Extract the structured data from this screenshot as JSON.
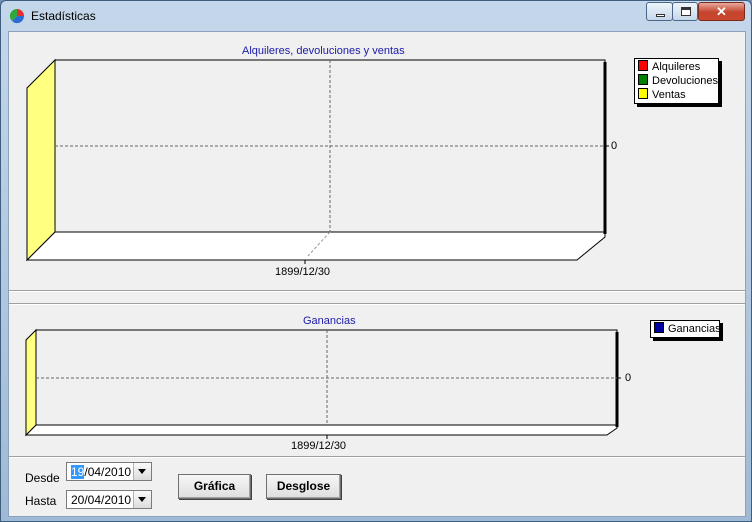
{
  "window": {
    "title": "Estadísticas",
    "close_glyph": "✕"
  },
  "chart_data": [
    {
      "type": "bar",
      "title": "Alquileres, devoluciones y ventas",
      "categories": [
        "1899/12/30"
      ],
      "series": [
        {
          "name": "Alquileres",
          "color": "#ff0000",
          "values": [
            0
          ]
        },
        {
          "name": "Devoluciones",
          "color": "#008000",
          "values": [
            0
          ]
        },
        {
          "name": "Ventas",
          "color": "#ffff00",
          "values": [
            0
          ]
        }
      ],
      "y_ticks": [
        "0"
      ],
      "grid": true,
      "legend": "top-right",
      "wall_color": "#ffff80"
    },
    {
      "type": "bar",
      "title": "Ganancias",
      "categories": [
        "1899/12/30"
      ],
      "series": [
        {
          "name": "Ganancias",
          "color": "#0000a0",
          "values": [
            0
          ]
        }
      ],
      "y_ticks": [
        "0"
      ],
      "grid": true,
      "legend": "top-right",
      "wall_color": "#ffff80"
    }
  ],
  "filters": {
    "desde_label": "Desde",
    "desde_day": "19",
    "desde_rest": "/04/2010",
    "hasta_label": "Hasta",
    "hasta_value": "20/04/2010"
  },
  "buttons": {
    "grafica": "Gráfica",
    "desglose": "Desglose"
  }
}
